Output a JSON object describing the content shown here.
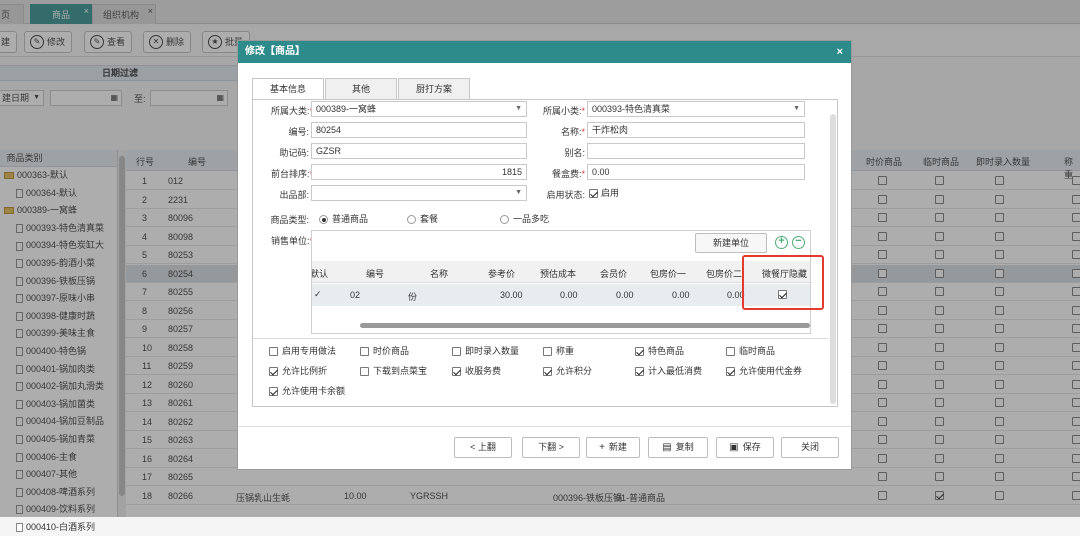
{
  "tabs": [
    {
      "label": "页",
      "active": false
    },
    {
      "label": "商品",
      "active": true
    },
    {
      "label": "组织机构",
      "active": false
    }
  ],
  "tab_close": "×",
  "toolbar": [
    {
      "label": "建",
      "icon": ""
    },
    {
      "label": "修改",
      "icon": "✎"
    },
    {
      "label": "查看",
      "icon": "✎"
    },
    {
      "label": "删除",
      "icon": "✕"
    },
    {
      "label": "批量",
      "icon": "★"
    }
  ],
  "filter": {
    "title": "日期过滤",
    "date_select": "建日期",
    "to_label": "至:"
  },
  "category_tree": {
    "header": "商品类别",
    "items": [
      {
        "label": "000363-默认",
        "type": "folder",
        "indent": 0
      },
      {
        "label": "000364-默认",
        "type": "doc",
        "indent": 1
      },
      {
        "label": "000389-一窝蜂",
        "type": "folder",
        "indent": 0
      },
      {
        "label": "000393-特色清真菜",
        "type": "doc",
        "indent": 1
      },
      {
        "label": "000394-特色炭缸大",
        "type": "doc",
        "indent": 1
      },
      {
        "label": "000395-韵酒小菜",
        "type": "doc",
        "indent": 1
      },
      {
        "label": "000396-铁板压锅",
        "type": "doc",
        "indent": 1
      },
      {
        "label": "000397-原味小串",
        "type": "doc",
        "indent": 1
      },
      {
        "label": "000398-健康时蔬",
        "type": "doc",
        "indent": 1
      },
      {
        "label": "000399-美味主食",
        "type": "doc",
        "indent": 1
      },
      {
        "label": "000400-特色锅",
        "type": "doc",
        "indent": 1
      },
      {
        "label": "000401-锅加肉类",
        "type": "doc",
        "indent": 1
      },
      {
        "label": "000402-锅加丸滑类",
        "type": "doc",
        "indent": 1
      },
      {
        "label": "000403-锅加菌类",
        "type": "doc",
        "indent": 1
      },
      {
        "label": "000404-锅加豆制品",
        "type": "doc",
        "indent": 1
      },
      {
        "label": "000405-锅加青菜",
        "type": "doc",
        "indent": 1
      },
      {
        "label": "000406-主食",
        "type": "doc",
        "indent": 1
      },
      {
        "label": "000407-其他",
        "type": "doc",
        "indent": 1
      },
      {
        "label": "000408-啤酒系列",
        "type": "doc",
        "indent": 1
      },
      {
        "label": "000409-饮料系列",
        "type": "doc",
        "indent": 1
      },
      {
        "label": "000410-白酒系列",
        "type": "doc",
        "indent": 1
      }
    ]
  },
  "grid": {
    "headers": [
      "行号",
      "编号",
      "时价商品",
      "临时商品",
      "即时录入数量",
      "称重"
    ],
    "rows": [
      {
        "no": "1",
        "code": "012",
        "c1": false,
        "c2": false,
        "c3": false,
        "c4": false
      },
      {
        "no": "2",
        "code": "2231",
        "c1": false,
        "c2": false,
        "c3": false,
        "c4": false
      },
      {
        "no": "3",
        "code": "80096",
        "c1": false,
        "c2": false,
        "c3": false,
        "c4": false
      },
      {
        "no": "4",
        "code": "80098",
        "c1": false,
        "c2": false,
        "c3": false,
        "c4": false
      },
      {
        "no": "5",
        "code": "80253",
        "c1": false,
        "c2": false,
        "c3": false,
        "c4": false
      },
      {
        "no": "6",
        "code": "80254",
        "c1": false,
        "c2": false,
        "c3": false,
        "c4": false
      },
      {
        "no": "7",
        "code": "80255",
        "c1": false,
        "c2": false,
        "c3": false,
        "c4": false
      },
      {
        "no": "8",
        "code": "80256",
        "c1": false,
        "c2": false,
        "c3": false,
        "c4": false
      },
      {
        "no": "9",
        "code": "80257",
        "c1": false,
        "c2": false,
        "c3": false,
        "c4": false
      },
      {
        "no": "10",
        "code": "80258",
        "c1": false,
        "c2": false,
        "c3": false,
        "c4": false
      },
      {
        "no": "11",
        "code": "80259",
        "c1": false,
        "c2": false,
        "c3": false,
        "c4": false
      },
      {
        "no": "12",
        "code": "80260",
        "c1": false,
        "c2": false,
        "c3": false,
        "c4": false
      },
      {
        "no": "13",
        "code": "80261",
        "c1": false,
        "c2": false,
        "c3": false,
        "c4": false
      },
      {
        "no": "14",
        "code": "80262",
        "c1": false,
        "c2": false,
        "c3": false,
        "c4": false
      },
      {
        "no": "15",
        "code": "80263",
        "c1": false,
        "c2": false,
        "c3": false,
        "c4": false
      },
      {
        "no": "16",
        "code": "80264",
        "c1": false,
        "c2": false,
        "c3": false,
        "c4": false
      },
      {
        "no": "17",
        "code": "80265",
        "c1": false,
        "c2": false,
        "c3": false,
        "c4": false
      },
      {
        "no": "18",
        "code": "80266",
        "c1": false,
        "c2": true,
        "c3": false,
        "c4": false,
        "name": "压锅乳山生蚝",
        "price": "10.00",
        "helper": "YGRSSH",
        "cat": "000396-铁板压锅",
        "dept": "01-普通商品"
      }
    ],
    "selected_row": "6"
  },
  "modal": {
    "title": "修改【商品】",
    "close": "×",
    "tabs": [
      "基本信息",
      "其他",
      "厨打方案"
    ],
    "active_tab": "基本信息",
    "fields": {
      "category_major_label": "所属大类:",
      "category_major_value": "000389-一窝蜂",
      "category_minor_label": "所属小类:",
      "category_minor_value": "000393-特色清真菜",
      "code_label": "编号:",
      "code_value": "80254",
      "name_label": "名称:",
      "name_value": "干炸松肉",
      "mnemonic_label": "助记码:",
      "mnemonic_value": "GZSR",
      "alias_label": "别名:",
      "alias_value": "",
      "sort_label": "前台排序:",
      "sort_value": "1815",
      "box_fee_label": "餐盒费:",
      "box_fee_value": "0.00",
      "dept_label": "出品部:",
      "dept_value": "",
      "status_label": "启用状态:",
      "status_value": "启用",
      "status_checked": true,
      "type_label": "商品类型:",
      "type_options": [
        "普通商品",
        "套餐",
        "一品多吃"
      ],
      "type_selected": "普通商品",
      "unit_label": "销售单位:"
    },
    "unit_table": {
      "new_button": "新建单位",
      "add": "+",
      "remove": "−",
      "headers": [
        "默认",
        "编号",
        "名称",
        "参考价",
        "预估成本",
        "会员价",
        "包房价一",
        "包房价二",
        "微餐厅隐藏"
      ],
      "rows": [
        {
          "default": true,
          "code": "02",
          "name": "份",
          "ref_price": "30.00",
          "cost": "0.00",
          "member": "0.00",
          "room1": "0.00",
          "room2": "0.00",
          "hidden": true
        }
      ]
    },
    "checks": [
      {
        "label": "启用专用做法",
        "checked": false
      },
      {
        "label": "时价商品",
        "checked": false
      },
      {
        "label": "即时录入数量",
        "checked": false
      },
      {
        "label": "称重",
        "checked": false
      },
      {
        "label": "特色商品",
        "checked": true
      },
      {
        "label": "临时商品",
        "checked": false
      },
      {
        "label": "允许比例折",
        "checked": true
      },
      {
        "label": "下载到点菜宝",
        "checked": false
      },
      {
        "label": "收服务费",
        "checked": true
      },
      {
        "label": "允许积分",
        "checked": true
      },
      {
        "label": "计入最低消费",
        "checked": true
      },
      {
        "label": "允许使用代金券",
        "checked": true
      },
      {
        "label": "允许使用卡余额",
        "checked": true
      }
    ],
    "footer": [
      {
        "label": "< 上翻",
        "icon": ""
      },
      {
        "label": "下翻 >",
        "icon": ""
      },
      {
        "label": "新建",
        "icon": "+"
      },
      {
        "label": "复制",
        "icon": "▤"
      },
      {
        "label": "保存",
        "icon": "▣"
      },
      {
        "label": "关闭",
        "icon": ""
      }
    ]
  },
  "colors": {
    "title_bar": "#2e8b8b",
    "highlight": "#e23a2e",
    "accent": "#4caf78"
  }
}
